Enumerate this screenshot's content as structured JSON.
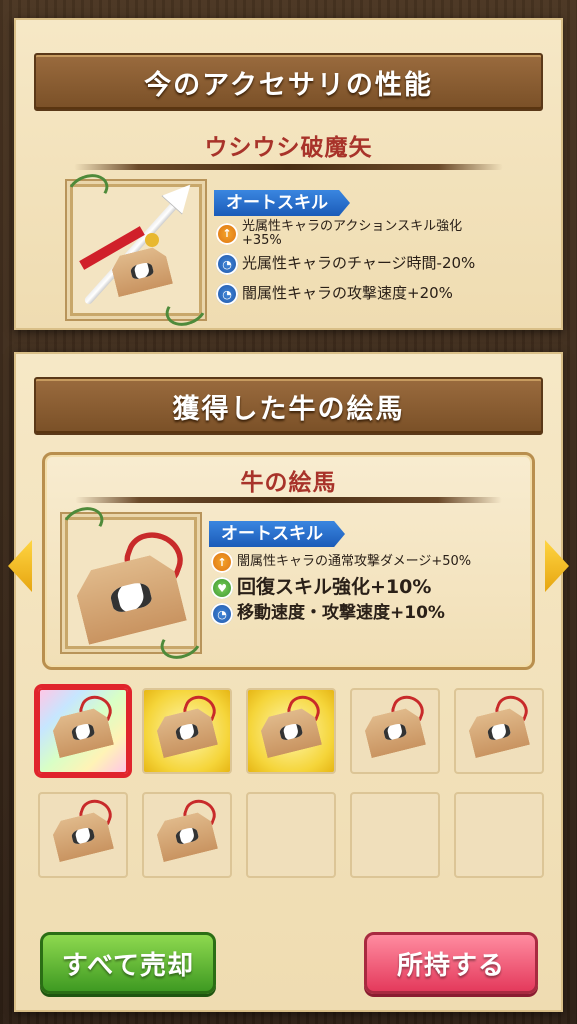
{
  "current": {
    "banner": "今のアクセサリの性能",
    "item_name": "ウシウシ破魔矢",
    "skill_tag": "オートスキル",
    "skills": [
      {
        "icon": "attack-up-icon",
        "text": "光属性キャラのアクションスキル強化+35%"
      },
      {
        "icon": "clock-icon",
        "text": "光属性キャラのチャージ時間-20%"
      },
      {
        "icon": "clock-icon",
        "text": "闇属性キャラの攻撃速度+20%"
      }
    ]
  },
  "obtained": {
    "banner": "獲得した牛の絵馬",
    "item_name": "牛の絵馬",
    "skill_tag": "オートスキル",
    "skills": [
      {
        "icon": "attack-up-icon",
        "text": "闇属性キャラの通常攻撃ダメージ+50%"
      },
      {
        "icon": "heal-icon",
        "text": "回復スキル強化+10%"
      },
      {
        "icon": "clock-icon",
        "text": "移動速度・攻撃速度+10%"
      }
    ]
  },
  "grid": [
    {
      "rarity": "rainbow",
      "filled": true,
      "selected": true
    },
    {
      "rarity": "gold",
      "filled": true,
      "selected": false
    },
    {
      "rarity": "gold",
      "filled": true,
      "selected": false
    },
    {
      "rarity": "normal",
      "filled": true,
      "selected": false
    },
    {
      "rarity": "normal",
      "filled": true,
      "selected": false
    },
    {
      "rarity": "normal",
      "filled": true,
      "selected": false
    },
    {
      "rarity": "normal",
      "filled": true,
      "selected": false
    },
    {
      "rarity": "normal",
      "filled": false,
      "selected": false
    },
    {
      "rarity": "normal",
      "filled": false,
      "selected": false
    },
    {
      "rarity": "normal",
      "filled": false,
      "selected": false
    }
  ],
  "buttons": {
    "sell_all": "すべて売却",
    "keep": "所持する"
  },
  "colors": {
    "title_red": "#a8332a",
    "banner_brown": "#7a5027",
    "sell_green": "#3f9a22",
    "keep_pink": "#e43a5c",
    "selected_red": "#e0242c"
  }
}
